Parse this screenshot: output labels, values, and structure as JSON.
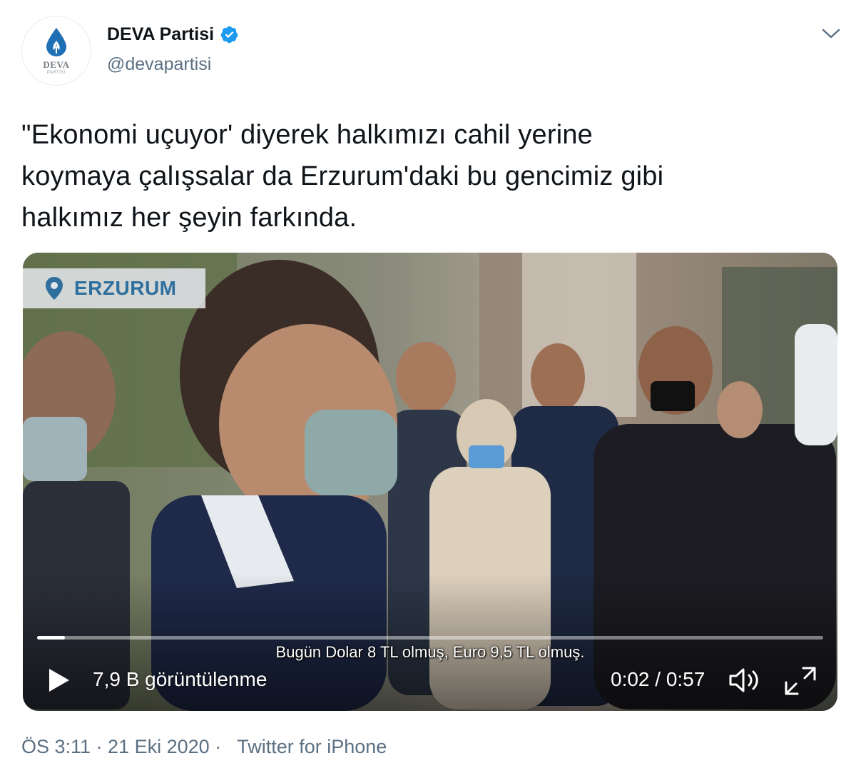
{
  "author": {
    "display_name": "DEVA Partisi",
    "handle": "@devapartisi",
    "avatar_logo_text": "DEVA",
    "avatar_logo_subtext": "PARTİSİ",
    "verified_icon": "verified-badge-icon"
  },
  "tweet": {
    "text_line_1": "\"Ekonomi uçuyor' diyerek halkımızı cahil yerine",
    "text_line_2": "koymaya çalışsalar da Erzurum'daki bu gencimiz gibi",
    "text_line_3": "halkımız her şeyin farkında."
  },
  "video": {
    "location_label": "ERZURUM",
    "subtitle": "Bugün Dolar 8 TL olmuş, Euro 9,5 TL olmuş.",
    "views": "7,9 B görüntülenme",
    "time": "0:02 / 0:57",
    "progress_fraction": 0.035
  },
  "meta": {
    "timestamp": "ÖS 3:11 · 21 Eki 2020 ·",
    "source": "Twitter for iPhone"
  },
  "colors": {
    "brand_blue": "#1d9bf0",
    "deva_blue": "#1f6fb5",
    "secondary_text": "#5b7083",
    "location_text": "#2e6f9e"
  }
}
